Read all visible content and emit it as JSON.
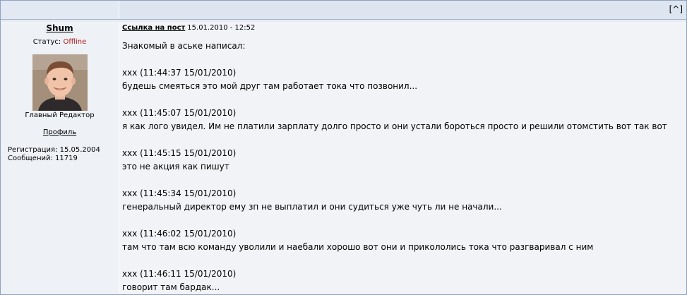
{
  "topbar": {
    "up_link": "[^]"
  },
  "author": {
    "name": "Shum",
    "status_label": "Статус:",
    "status_value": "Offline",
    "rank": "Главный Редактор",
    "profile_link": "Профиль",
    "registration": "Регистрация: 15.05.2004",
    "messages": "Сообщений: 11719"
  },
  "post": {
    "link_label": "Ссылка на пост",
    "date": "15.01.2010 - 12:52",
    "intro": "Знакомый в аське написал:",
    "messages": [
      {
        "header": "xxx (11:44:37 15/01/2010)",
        "text": "будешь смеяться это мой друг там работает тока что позвонил..."
      },
      {
        "header": "xxx (11:45:07 15/01/2010)",
        "text": "я как лого увидел. Им не платили зарплату долго просто и они устали бороться просто и решили отомстить вот так вот"
      },
      {
        "header": "xxx (11:45:15 15/01/2010)",
        "text": "это не акция как пишут"
      },
      {
        "header": "xxx (11:45:34 15/01/2010)",
        "text": "генеральный директор ему зп не выплатил и они судиться уже чуть ли не начали..."
      },
      {
        "header": "xxx (11:46:02 15/01/2010)",
        "text": "там что там всю команду уволили и наебали хорошо вот они и прикололись тока что разгваривал с ним"
      },
      {
        "header": "xxx (11:46:11 15/01/2010)",
        "text": "говорит там бардак..."
      }
    ]
  }
}
